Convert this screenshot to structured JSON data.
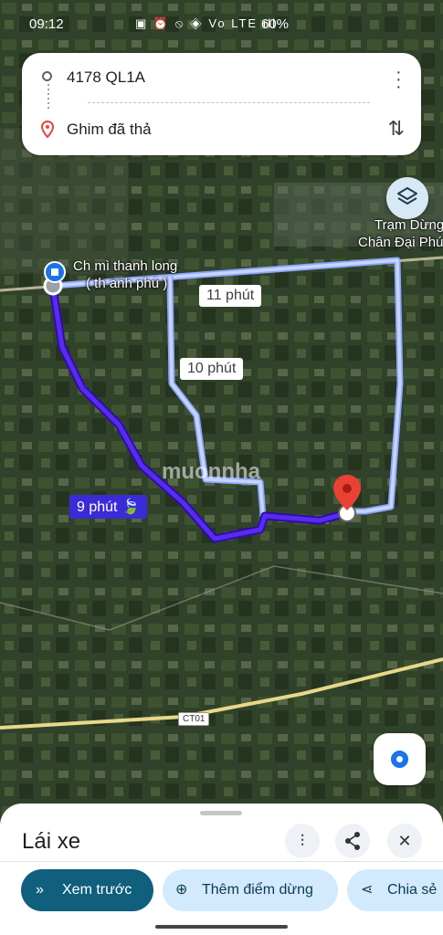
{
  "status_bar": {
    "time": "09:12",
    "icons": "▣ ⏰ ⦸ ◈ Vo LTE ıll",
    "battery": "60%"
  },
  "directions": {
    "origin": "4178 QL1A",
    "destination": "Ghim đã thả"
  },
  "map": {
    "labels": {
      "place_top_right_1": "Trạm Dừng",
      "place_top_right_2": "Chân Đại Phú",
      "origin_label_1": "Ch mì thanh long",
      "origin_label_2": "( th anh phú )",
      "road": "CT01"
    },
    "routes": [
      {
        "label": "11 phút",
        "type": "alternate"
      },
      {
        "label": "10 phút",
        "type": "alternate"
      },
      {
        "label": "9 phút",
        "type": "best"
      }
    ],
    "watermark": "muonnha"
  },
  "sheet": {
    "title": "Lái xe",
    "chips": {
      "preview": "Xem trước",
      "add_stop": "Thêm điểm dừng",
      "share": "Chia sẻ"
    }
  },
  "colors": {
    "route_main": "#4a1fd1",
    "route_alt": "#9fb6f5",
    "pin": "#e94235"
  }
}
